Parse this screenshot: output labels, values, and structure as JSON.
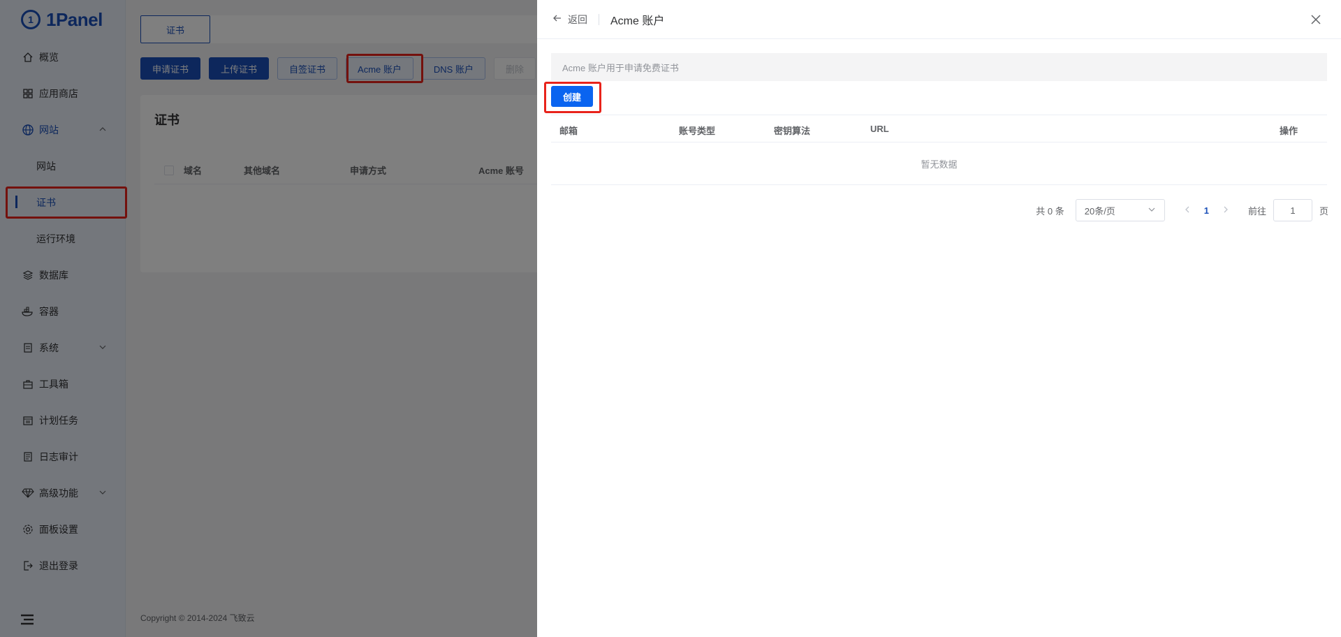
{
  "app": {
    "logo_mark": "1",
    "logo_text": "1Panel"
  },
  "sidebar": {
    "items": [
      {
        "label": "概览",
        "icon": "home-icon"
      },
      {
        "label": "应用商店",
        "icon": "grid-icon"
      },
      {
        "label": "网站",
        "icon": "globe-icon",
        "expanded": true
      },
      {
        "label": "网站",
        "sub": true
      },
      {
        "label": "证书",
        "sub": true,
        "active": true
      },
      {
        "label": "运行环境",
        "sub": true
      },
      {
        "label": "数据库",
        "icon": "layers-icon"
      },
      {
        "label": "容器",
        "icon": "docker-icon"
      },
      {
        "label": "系统",
        "icon": "server-icon"
      },
      {
        "label": "工具箱",
        "icon": "toolbox-icon"
      },
      {
        "label": "计划任务",
        "icon": "calendar-icon"
      },
      {
        "label": "日志审计",
        "icon": "log-icon"
      },
      {
        "label": "高级功能",
        "icon": "diamond-icon"
      },
      {
        "label": "面板设置",
        "icon": "gear-icon"
      },
      {
        "label": "退出登录",
        "icon": "logout-icon"
      }
    ]
  },
  "main": {
    "tab": "证书",
    "toolbar": {
      "apply": "申请证书",
      "upload": "上传证书",
      "self_sign": "自签证书",
      "acme": "Acme 账户",
      "dns": "DNS 账户",
      "delete": "删除"
    },
    "card_title": "证书",
    "columns": [
      "域名",
      "其他域名",
      "申请方式",
      "Acme 账号"
    ],
    "footer": "Copyright © 2014-2024 飞致云"
  },
  "drawer": {
    "back": "返回",
    "title": "Acme 账户",
    "hint": "Acme 账户用于申请免费证书",
    "create": "创建",
    "columns": {
      "email": "邮箱",
      "type": "账号类型",
      "key": "密钥算法",
      "url": "URL",
      "ops": "操作"
    },
    "empty": "暂无数据",
    "pager": {
      "total": "共 0 条",
      "page_size": "20条/页",
      "current": "1",
      "goto": "前往",
      "goto_value": "1",
      "page_suffix": "页"
    }
  },
  "colors": {
    "primary": "#1a4fb8",
    "button": "#0a64f0",
    "highlight": "#e8231b"
  }
}
